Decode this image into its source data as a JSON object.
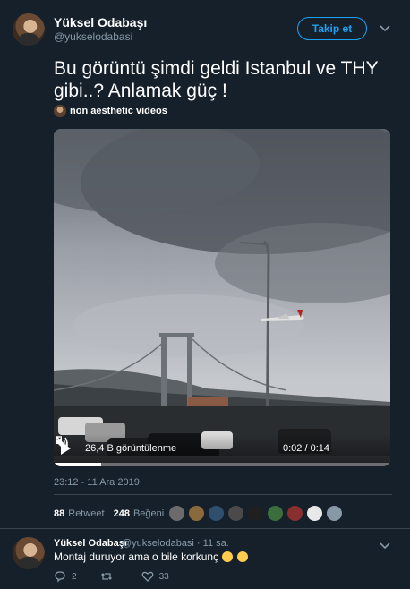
{
  "tweet": {
    "author_name": "Yüksel Odabaşı",
    "author_handle": "@yukselodabasi",
    "follow_label": "Takip et",
    "text_line1": "Bu görüntü şimdi geldi Istanbul ve THY",
    "text_line2": "gibi..? Anlamak güç !",
    "source_label": "non aesthetic videos",
    "video": {
      "views": "26,4 B görüntülenme",
      "time": "0:02 / 0:14",
      "progress": 0.14
    },
    "timestamp": "23:12 - 11 Ara 2019",
    "retweets_count": "88",
    "retweets_label": "Retweet",
    "likes_count": "248",
    "likes_label": "Beğeni",
    "liker_colors": [
      "#6b6b6b",
      "#8a6a3c",
      "#2f4f6f",
      "#4a4a4a",
      "#1f1f1f",
      "#3c6e3c",
      "#8a2f2f",
      "#e8e8e8",
      "#8899a6"
    ]
  },
  "reply": {
    "author_name": "Yüksel Odabaşı",
    "author_handle": "@yukselodabasi · 11 sa.",
    "text": "Montaj duruyor ama o bile korkunç",
    "reply_count": "2",
    "retweet_count": "",
    "like_count": "33"
  },
  "icons": {
    "caret": "chevron-down-icon",
    "play": "play-icon",
    "volume": "volume-icon",
    "fullscreen": "fullscreen-icon",
    "reply": "reply-icon",
    "retweet": "retweet-icon",
    "like": "heart-icon"
  },
  "colors": {
    "background": "#15202b",
    "accent": "#1da1f2",
    "secondary_text": "#8899a6"
  }
}
